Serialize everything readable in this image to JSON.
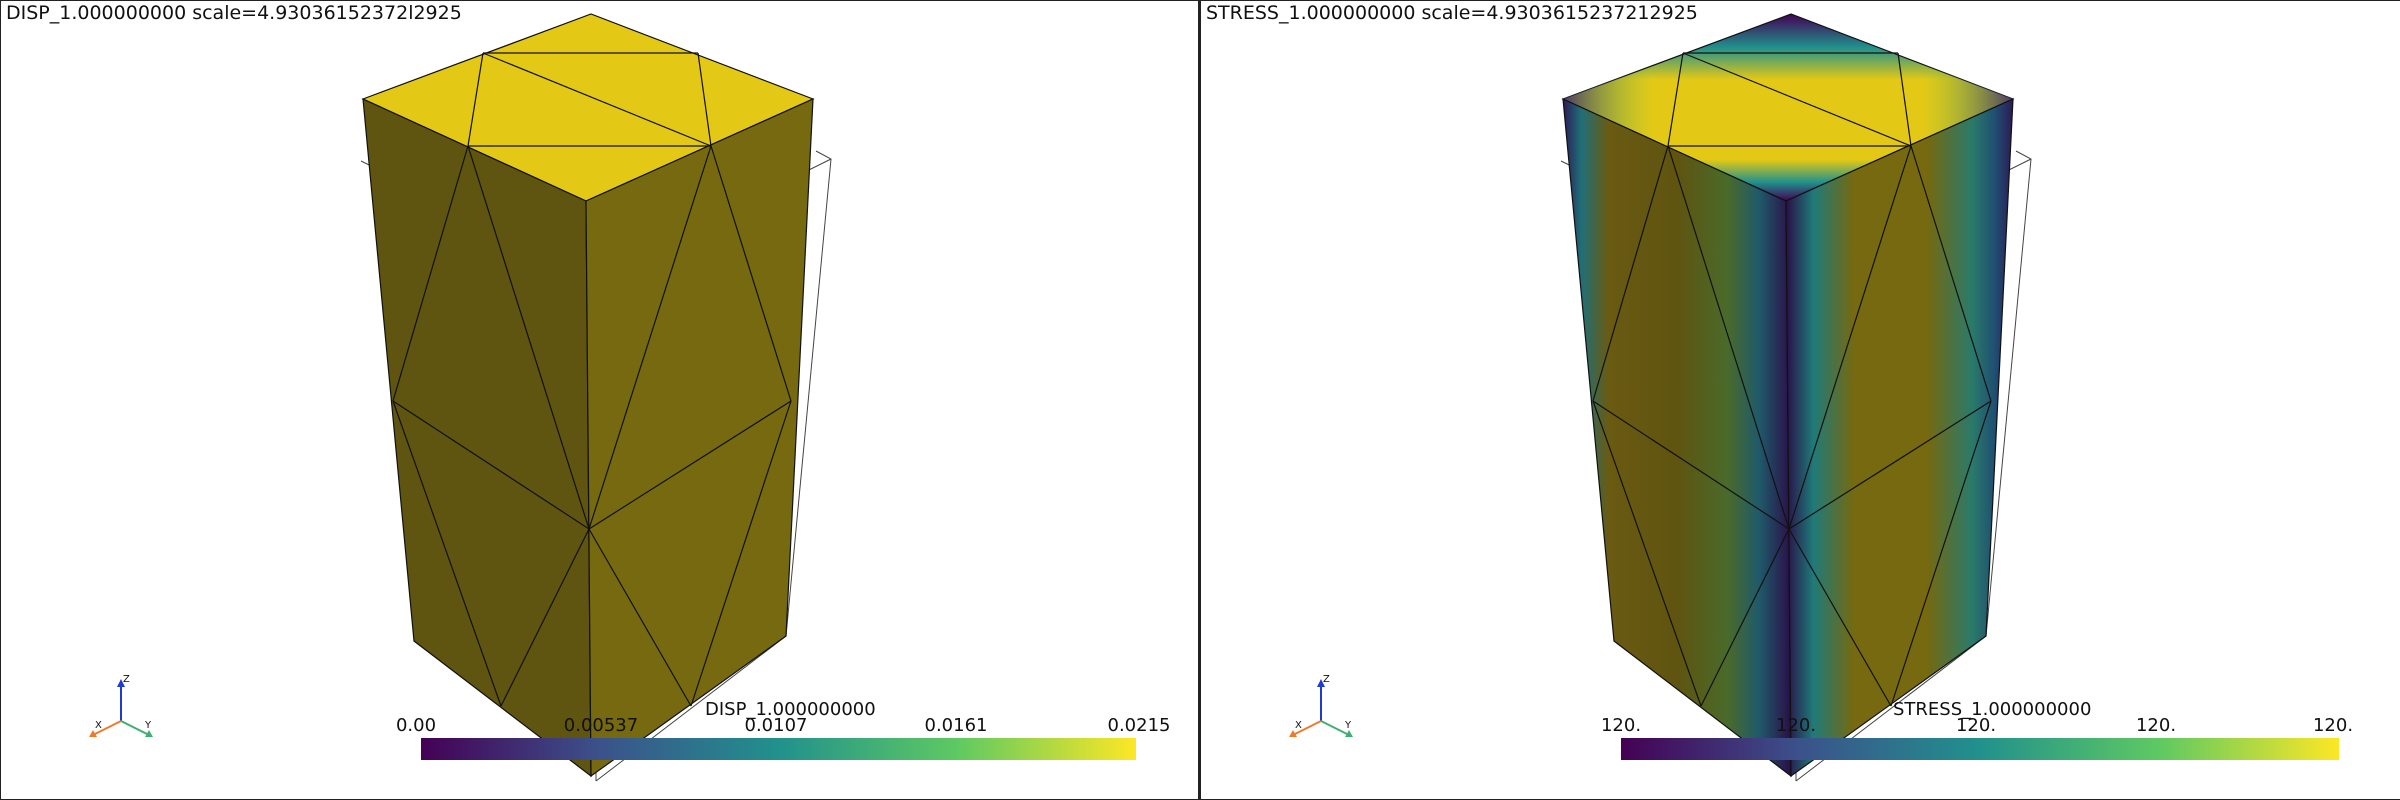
{
  "left": {
    "title": "DISP_1.000000000 scale=4.93036152372l2925",
    "colorbar": {
      "title": "DISP_1.000000000",
      "ticks": [
        "0.00",
        "0.00537",
        "0.0107",
        "0.0161",
        "0.0215"
      ]
    },
    "axes": {
      "x": "X",
      "y": "Y",
      "z": "Z"
    }
  },
  "right": {
    "title": "STRESS_1.000000000 scale=4.9303615237212925",
    "colorbar": {
      "title": "STRESS_1.000000000",
      "ticks": [
        "120.",
        "120.",
        "120.",
        "120.",
        "120."
      ]
    },
    "axes": {
      "x": "X",
      "y": "Y",
      "z": "Z"
    }
  },
  "colors": {
    "top_face": "#e3c816",
    "left_face": "#5f5410",
    "right_face": "#76690f",
    "colormap": [
      "#440154",
      "#3b528b",
      "#21918c",
      "#5ec962",
      "#fde725"
    ]
  }
}
